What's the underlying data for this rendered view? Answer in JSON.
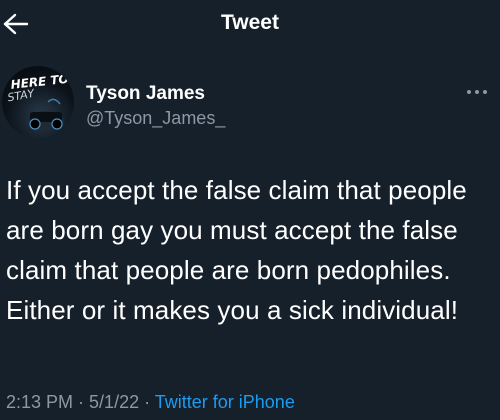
{
  "header": {
    "title": "Tweet",
    "back_icon": "arrow-left-icon"
  },
  "author": {
    "name": "Tyson James",
    "handle": "@Tyson_James_",
    "avatar_text": "HERE TO STAY"
  },
  "more_icon": "more-horizontal-icon",
  "tweet": {
    "text": "If you accept the false claim that people are born gay you must accept the false claim that people are born pedophiles. Either or it makes you a sick individual!"
  },
  "meta": {
    "time": "2:13 PM",
    "separator": " · ",
    "date": "5/1/22",
    "source": "Twitter for iPhone"
  },
  "colors": {
    "background": "#15202b",
    "secondary_text": "#8b98a5",
    "link": "#1d9bf0"
  }
}
